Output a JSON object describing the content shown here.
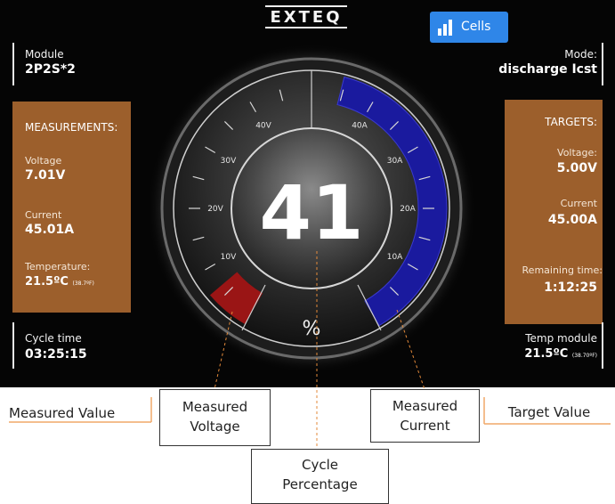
{
  "header": {
    "logo_text": "EXTEQ",
    "cells_button_label": "Cells"
  },
  "module": {
    "label": "Module",
    "value": "2P2S*2"
  },
  "mode": {
    "label": "Mode:",
    "value": "discharge Icst"
  },
  "measurements": {
    "title": "MEASUREMENTS:",
    "voltage_label": "Voltage",
    "voltage_value": "7.01V",
    "current_label": "Current",
    "current_value": "45.01A",
    "temperature_label": "Temperature:",
    "temperature_value": "21.5ºC",
    "temperature_f": "(38.7ºF)"
  },
  "targets": {
    "title": "TARGETS:",
    "voltage_label": "Voltage:",
    "voltage_value": "5.00V",
    "current_label": "Current",
    "current_value": "45.00A",
    "remaining_label": "Remaining time:",
    "remaining_value": "1:12:25"
  },
  "cycle_time": {
    "label": "Cycle time",
    "value": "03:25:15"
  },
  "temp_module": {
    "label": "Temp module",
    "value": "21.5ºC",
    "value_f": "(38.70ºF)"
  },
  "gauge": {
    "percentage": "41",
    "percent_symbol": "%",
    "voltage_ticks": [
      "10V",
      "20V",
      "30V",
      "40V"
    ],
    "current_ticks": [
      "10A",
      "20A",
      "30A",
      "40A"
    ],
    "measured_current_level": 1.0,
    "measured_voltage_level": 0.13
  },
  "annotations": {
    "measured_value": "Measured Value",
    "measured_voltage": "Measured\nVoltage",
    "measured_current": "Measured\nCurrent",
    "cycle_percentage": "Cycle\nPercentage",
    "target_value": "Target Value"
  },
  "colors": {
    "accent_blue": "#2f86e8",
    "panel_orange": "#c67837",
    "current_arc": "#1a1a9e",
    "voltage_arc": "#9a1515"
  }
}
